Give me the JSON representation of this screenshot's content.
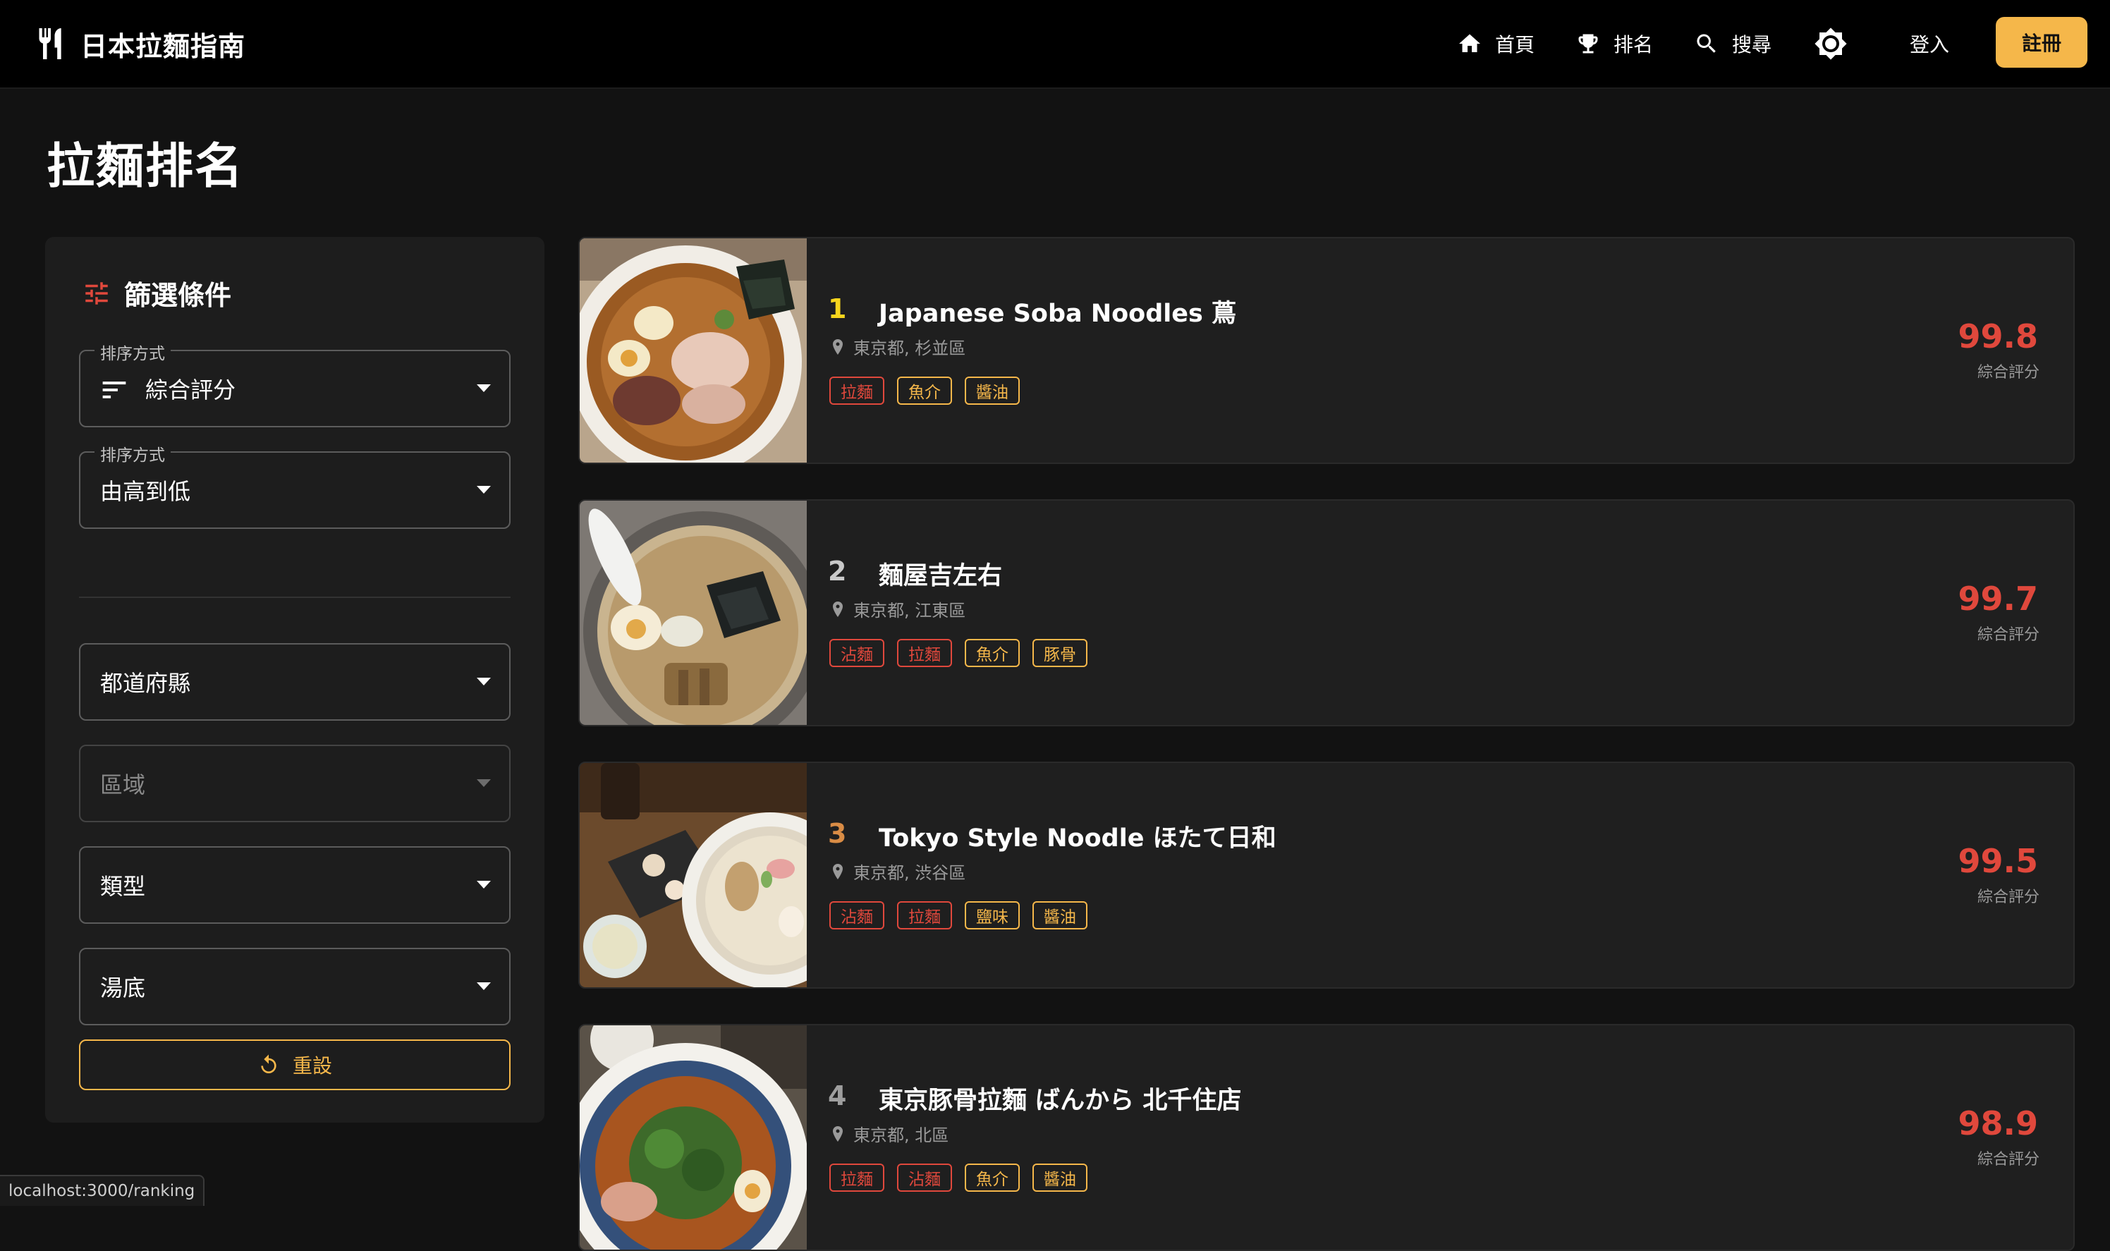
{
  "header": {
    "brand": "日本拉麵指南",
    "nav": [
      {
        "label": "首頁",
        "icon": "home-icon"
      },
      {
        "label": "排名",
        "icon": "trophy-icon"
      },
      {
        "label": "搜尋",
        "icon": "search-icon"
      }
    ],
    "theme_icon": "brightness-icon",
    "login": "登入",
    "register": "註冊"
  },
  "page": {
    "title": "拉麵排名"
  },
  "filters": {
    "title": "篩選條件",
    "sort_by": {
      "label": "排序方式",
      "value": "綜合評分"
    },
    "order": {
      "label": "排序方式",
      "value": "由高到低"
    },
    "prefecture": {
      "placeholder": "都道府縣"
    },
    "area": {
      "placeholder": "區域"
    },
    "type": {
      "placeholder": "類型"
    },
    "broth": {
      "placeholder": "湯底"
    },
    "reset": "重設"
  },
  "colors": {
    "accent": "#f5b74a",
    "score": "#e0483c",
    "rank1": "#f7d51d",
    "rank2": "#c9c9c9",
    "rank3": "#d98c45",
    "rank_other": "#9e9e9e"
  },
  "rankings": [
    {
      "rank": "1",
      "name": "Japanese Soba Noodles 蔦",
      "location": "東京都, 杉並區",
      "tags": [
        {
          "text": "拉麵",
          "style": "red"
        },
        {
          "text": "魚介",
          "style": "gold"
        },
        {
          "text": "醬油",
          "style": "gold"
        }
      ],
      "score": "99.8",
      "score_label": "綜合評分"
    },
    {
      "rank": "2",
      "name": "麵屋吉左右",
      "location": "東京都, 江東區",
      "tags": [
        {
          "text": "沾麵",
          "style": "red"
        },
        {
          "text": "拉麵",
          "style": "red"
        },
        {
          "text": "魚介",
          "style": "gold"
        },
        {
          "text": "豚骨",
          "style": "gold"
        }
      ],
      "score": "99.7",
      "score_label": "綜合評分"
    },
    {
      "rank": "3",
      "name": "Tokyo Style Noodle ほたて日和",
      "location": "東京都, 渋谷區",
      "tags": [
        {
          "text": "沾麵",
          "style": "red"
        },
        {
          "text": "拉麵",
          "style": "red"
        },
        {
          "text": "鹽味",
          "style": "gold"
        },
        {
          "text": "醬油",
          "style": "gold"
        }
      ],
      "score": "99.5",
      "score_label": "綜合評分"
    },
    {
      "rank": "4",
      "name": "東京豚骨拉麵 ばんから 北千住店",
      "location": "東京都, 北區",
      "tags": [
        {
          "text": "拉麵",
          "style": "red"
        },
        {
          "text": "沾麵",
          "style": "red"
        },
        {
          "text": "魚介",
          "style": "gold"
        },
        {
          "text": "醬油",
          "style": "gold"
        }
      ],
      "score": "98.9",
      "score_label": "綜合評分"
    }
  ],
  "status_url": "localhost:3000/ranking"
}
